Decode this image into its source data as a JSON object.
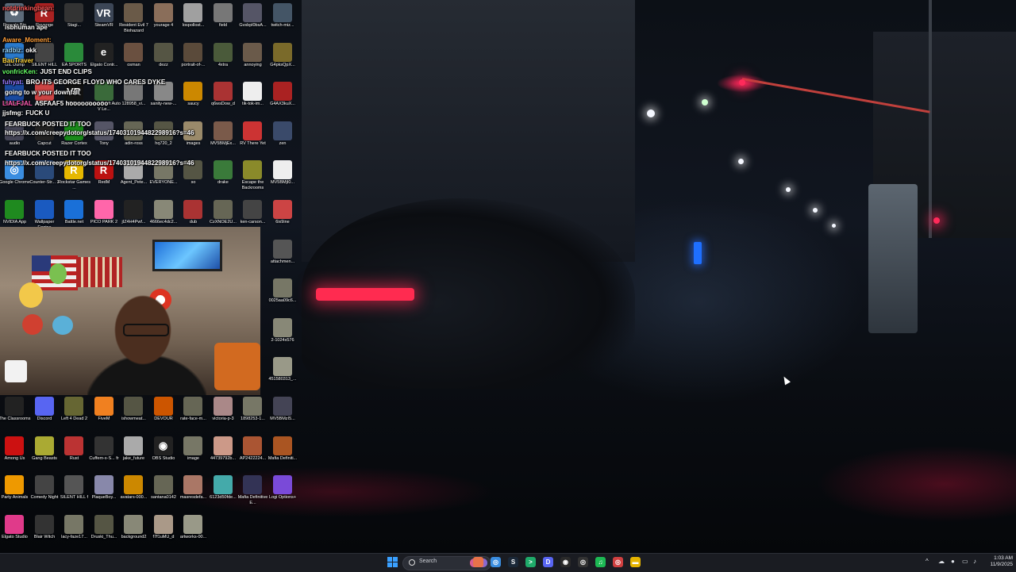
{
  "chat": {
    "messages": [
      {
        "user": "notdrinkingbean:",
        "text": "",
        "color": "#ff5a5a"
      },
      {
        "user": "",
        "text": "isbhuman ape",
        "color": "#ffffff"
      },
      {
        "user": "Aware_Moment:",
        "text": "",
        "color": "#ff9f3a"
      },
      {
        "user": "radbiz:",
        "text": "okk",
        "color": "#9ad8ff"
      },
      {
        "user": "BauTraver",
        "text": "",
        "color": "#ffd23a"
      },
      {
        "user": "vonfricKen:",
        "text": "JUST END CLIPS",
        "color": "#66ff66"
      },
      {
        "user": "fuhyat:",
        "text": "BRO ITS GEORGE FLOYD WHO CARES DYKE",
        "color": "#9a7aff"
      },
      {
        "user": "",
        "text": "going to w your downfall",
        "color": "#ffffff"
      },
      {
        "user": "LIALFJAL",
        "text": "ASFAAF5  hoooooooooo",
        "color": "#ff5ab4"
      },
      {
        "user": "jjsfmg:",
        "text": "FUCK U",
        "color": "#ffffff"
      },
      {
        "user": "",
        "text": "FEARBUCK POSTED IT TOO",
        "color": "#ffffff"
      },
      {
        "user": "",
        "text": "https://x.com/creepydotorg/status/1740310194482298916?s=46",
        "color": "#ffffff"
      },
      {
        "user": "",
        "text": "FEARBUCK POSTED IT TOO",
        "color": "#ffffff"
      },
      {
        "user": "",
        "text": "https://x.com/creepydotorg/status/1740310194482298916?s=46",
        "color": "#ffffff"
      }
    ]
  },
  "desktop": {
    "icons": [
      {
        "label": "Recycle Bin",
        "icon": "recycle-bin-icon",
        "color": "#5d6b7a",
        "glyph": "♻"
      },
      {
        "label": "Revenge",
        "icon": "game-icon",
        "color": "#a22",
        "glyph": "R"
      },
      {
        "label": "Stagi...",
        "icon": "app-icon",
        "color": "#333",
        "glyph": ""
      },
      {
        "label": "SteamVR",
        "icon": "steamvr-icon",
        "color": "#3c4656",
        "glyph": "VR"
      },
      {
        "label": "Resident Evil 7 Biohazard",
        "icon": "game-icon",
        "color": "#6a5a48",
        "glyph": ""
      },
      {
        "label": "yourage 4",
        "icon": "image-file-icon",
        "color": "#8a6e5a",
        "glyph": ""
      },
      {
        "label": "lospollost...",
        "icon": "image-file-icon",
        "color": "#a0a0a0",
        "glyph": ""
      },
      {
        "label": "field",
        "icon": "image-file-icon",
        "color": "#777",
        "glyph": ""
      },
      {
        "label": "Gvsbpl0bsA...",
        "icon": "image-file-icon",
        "color": "#556",
        "glyph": ""
      },
      {
        "label": "twitch-miz...",
        "icon": "image-file-icon",
        "color": "#456",
        "glyph": ""
      },
      {
        "label": "GIL Dump",
        "icon": "app-icon",
        "color": "#2a7acc",
        "glyph": ""
      },
      {
        "label": "SILENT HILL",
        "icon": "game-icon",
        "color": "#444",
        "glyph": ""
      },
      {
        "label": "EA SPORTS",
        "icon": "game-icon",
        "color": "#2a8a3a",
        "glyph": ""
      },
      {
        "label": "Elgato Contr...",
        "icon": "elgato-icon",
        "color": "#222",
        "glyph": "e"
      },
      {
        "label": "osman",
        "icon": "image-file-icon",
        "color": "#6a5040",
        "glyph": ""
      },
      {
        "label": "dezz",
        "icon": "image-file-icon",
        "color": "#554",
        "glyph": ""
      },
      {
        "label": "portrait-of-...",
        "icon": "image-file-icon",
        "color": "#5a4a3a",
        "glyph": ""
      },
      {
        "label": "4xtra",
        "icon": "image-file-icon",
        "color": "#4a5a3a",
        "glyph": ""
      },
      {
        "label": "annoying",
        "icon": "image-file-icon",
        "color": "#6a5a4a",
        "glyph": ""
      },
      {
        "label": "G4pksQpX...",
        "icon": "image-file-icon",
        "color": "#7a6a2a",
        "glyph": ""
      },
      {
        "label": "PS Remote",
        "icon": "app-icon",
        "color": "#1a4aa0",
        "glyph": ""
      },
      {
        "label": "PEAK",
        "icon": "game-icon",
        "color": "#c44",
        "glyph": ""
      },
      {
        "label": "VRChat",
        "icon": "vrchat-icon",
        "color": "#111",
        "glyph": "VR"
      },
      {
        "label": "Grand Theft Auto V Le...",
        "icon": "game-icon",
        "color": "#3a6a3a",
        "glyph": ""
      },
      {
        "label": "128958_vi...",
        "icon": "image-file-icon",
        "color": "#777",
        "glyph": ""
      },
      {
        "label": "sanity-new-...",
        "icon": "image-file-icon",
        "color": "#888",
        "glyph": ""
      },
      {
        "label": "saucy",
        "icon": "image-file-icon",
        "color": "#c80",
        "glyph": ""
      },
      {
        "label": "q6wsDow_d",
        "icon": "image-file-icon",
        "color": "#a33",
        "glyph": ""
      },
      {
        "label": "tik-tok-im...",
        "icon": "image-file-icon",
        "color": "#eee",
        "glyph": ""
      },
      {
        "label": "G4AX3kuX...",
        "icon": "image-file-icon",
        "color": "#a22",
        "glyph": ""
      },
      {
        "label": "audio",
        "icon": "app-icon",
        "color": "#445",
        "glyph": ""
      },
      {
        "label": "Capcut",
        "icon": "app-icon",
        "color": "#222",
        "glyph": ""
      },
      {
        "label": "Razer Cortex",
        "icon": "razer-icon",
        "color": "#1a8a1a",
        "glyph": ""
      },
      {
        "label": "Tony",
        "icon": "image-file-icon",
        "color": "#556",
        "glyph": ""
      },
      {
        "label": "adin-ross",
        "icon": "image-file-icon",
        "color": "#665",
        "glyph": ""
      },
      {
        "label": "hq720_2",
        "icon": "image-file-icon",
        "color": "#554",
        "glyph": ""
      },
      {
        "label": "images",
        "icon": "image-file-icon",
        "color": "#9a8a6a",
        "glyph": ""
      },
      {
        "label": "MV5BMjEx...",
        "icon": "image-file-icon",
        "color": "#7a5a4a",
        "glyph": ""
      },
      {
        "label": "RV There Yet",
        "icon": "game-icon",
        "color": "#c33",
        "glyph": ""
      },
      {
        "label": "zen",
        "icon": "image-file-icon",
        "color": "#3a4a6a",
        "glyph": ""
      },
      {
        "label": "Google Chrome",
        "icon": "chrome-icon",
        "color": "#3a8de0",
        "glyph": "◎"
      },
      {
        "label": "Counter-Str... 2",
        "icon": "game-icon",
        "color": "#2a4a7a",
        "glyph": ""
      },
      {
        "label": "Rockstar Games ...",
        "icon": "rockstar-icon",
        "color": "#e6b800",
        "glyph": "R"
      },
      {
        "label": "RedM",
        "icon": "game-icon",
        "color": "#b11",
        "glyph": "R"
      },
      {
        "label": "Agent_Pete...",
        "icon": "image-file-icon",
        "color": "#aaa",
        "glyph": ""
      },
      {
        "label": "EVERYONE...",
        "icon": "image-file-icon",
        "color": "#776",
        "glyph": ""
      },
      {
        "label": "so",
        "icon": "image-file-icon",
        "color": "#554",
        "glyph": ""
      },
      {
        "label": "drake",
        "icon": "image-file-icon",
        "color": "#3a7a3a",
        "glyph": ""
      },
      {
        "label": "Escape the Backrooms",
        "icon": "game-icon",
        "color": "#8a8a2a",
        "glyph": ""
      },
      {
        "label": "MV5BMjI0...",
        "icon": "image-file-icon",
        "color": "#eee",
        "glyph": ""
      },
      {
        "label": "NVIDIA App",
        "icon": "nvidia-icon",
        "color": "#1f8a1f",
        "glyph": ""
      },
      {
        "label": "Wallpaper Engine",
        "icon": "wallpaper-engine-icon",
        "color": "#1a5ac0",
        "glyph": ""
      },
      {
        "label": "Battle.net",
        "icon": "battlenet-icon",
        "color": "#1a70d8",
        "glyph": ""
      },
      {
        "label": "PICO PARK 2",
        "icon": "game-icon",
        "color": "#f6a",
        "glyph": ""
      },
      {
        "label": "jIZ4H4Pwf...",
        "icon": "image-file-icon",
        "color": "#222",
        "glyph": ""
      },
      {
        "label": "4666ec4dc2...",
        "icon": "image-file-icon",
        "color": "#887",
        "glyph": ""
      },
      {
        "label": "dub",
        "icon": "image-file-icon",
        "color": "#a33",
        "glyph": ""
      },
      {
        "label": "CzXNOE2U...",
        "icon": "image-file-icon",
        "color": "#665",
        "glyph": ""
      },
      {
        "label": "ken-carson...",
        "icon": "image-file-icon",
        "color": "#444",
        "glyph": ""
      },
      {
        "label": "6ix9ine",
        "icon": "image-file-icon",
        "color": "#c44",
        "glyph": ""
      },
      {
        "label": "attachmen...",
        "icon": "image-file-icon",
        "color": "#555",
        "glyph": ""
      },
      {
        "label": "0025aa09c6...",
        "icon": "image-file-icon",
        "color": "#776",
        "glyph": ""
      },
      {
        "label": "2-1024x576",
        "icon": "image-file-icon",
        "color": "#887",
        "glyph": ""
      },
      {
        "label": "451580313_...",
        "icon": "image-file-icon",
        "color": "#998",
        "glyph": ""
      },
      {
        "label": "The Classrooms",
        "icon": "game-icon",
        "color": "#222",
        "glyph": ""
      },
      {
        "label": "Discord",
        "icon": "discord-icon",
        "color": "#5865f2",
        "glyph": ""
      },
      {
        "label": "Left 4 Dead 2",
        "icon": "game-icon",
        "color": "#663",
        "glyph": ""
      },
      {
        "label": "FiveM",
        "icon": "fivem-icon",
        "color": "#f08020",
        "glyph": ""
      },
      {
        "label": "ishowmeat...",
        "icon": "image-file-icon",
        "color": "#554",
        "glyph": ""
      },
      {
        "label": "DEVOUR",
        "icon": "game-icon",
        "color": "#c50",
        "glyph": ""
      },
      {
        "label": "rate-face-m...",
        "icon": "image-file-icon",
        "color": "#665",
        "glyph": ""
      },
      {
        "label": "victoria-p-3",
        "icon": "image-file-icon",
        "color": "#a88",
        "glyph": ""
      },
      {
        "label": "1898253-1...",
        "icon": "image-file-icon",
        "color": "#776",
        "glyph": ""
      },
      {
        "label": "MV5BMzI5...",
        "icon": "image-file-icon",
        "color": "#445",
        "glyph": ""
      },
      {
        "label": "Among Us",
        "icon": "game-icon",
        "color": "#c11",
        "glyph": ""
      },
      {
        "label": "Gang Beasts",
        "icon": "game-icon",
        "color": "#aa3",
        "glyph": ""
      },
      {
        "label": "Rust",
        "icon": "game-icon",
        "color": "#b33",
        "glyph": ""
      },
      {
        "label": "Cuffem-x-S... fr",
        "icon": "image-file-icon",
        "color": "#333",
        "glyph": ""
      },
      {
        "label": "jake_future",
        "icon": "image-file-icon",
        "color": "#aaa",
        "glyph": ""
      },
      {
        "label": "OBS Studio",
        "icon": "obs-icon",
        "color": "#222",
        "glyph": "◉"
      },
      {
        "label": "image",
        "icon": "image-file-icon",
        "color": "#776",
        "glyph": ""
      },
      {
        "label": "44739792b...",
        "icon": "image-file-icon",
        "color": "#c98",
        "glyph": ""
      },
      {
        "label": "AP2422224...",
        "icon": "image-file-icon",
        "color": "#a53",
        "glyph": ""
      },
      {
        "label": "Mafia Definiti...",
        "icon": "game-icon",
        "color": "#a52",
        "glyph": ""
      },
      {
        "label": "Party Animals",
        "icon": "game-icon",
        "color": "#e90",
        "glyph": ""
      },
      {
        "label": "Comedy Night",
        "icon": "game-icon",
        "color": "#444",
        "glyph": ""
      },
      {
        "label": "SILENT HILL f",
        "icon": "game-icon",
        "color": "#555",
        "glyph": ""
      },
      {
        "label": "PlaqueBoy...",
        "icon": "image-file-icon",
        "color": "#88a",
        "glyph": ""
      },
      {
        "label": "avatars-000...",
        "icon": "image-file-icon",
        "color": "#c80",
        "glyph": ""
      },
      {
        "label": "santana0142",
        "icon": "image-file-icon",
        "color": "#665",
        "glyph": ""
      },
      {
        "label": "masresdefa...",
        "icon": "image-file-icon",
        "color": "#a76",
        "glyph": ""
      },
      {
        "label": "6123d50fde...",
        "icon": "image-file-icon",
        "color": "#4aa",
        "glyph": ""
      },
      {
        "label": "Mafia Definitive E...",
        "icon": "game-icon",
        "color": "#335",
        "glyph": ""
      },
      {
        "label": "Logi Options+",
        "icon": "logi-icon",
        "color": "#7a4ad8",
        "glyph": ""
      },
      {
        "label": "Elgato Studio",
        "icon": "elgato-studio-icon",
        "color": "#e03a8a",
        "glyph": ""
      },
      {
        "label": "Blair Witch",
        "icon": "game-icon",
        "color": "#333",
        "glyph": ""
      },
      {
        "label": "lacy-faze17...",
        "icon": "image-file-icon",
        "color": "#776",
        "glyph": ""
      },
      {
        "label": "Druski_Thu...",
        "icon": "image-file-icon",
        "color": "#554",
        "glyph": ""
      },
      {
        "label": "background2",
        "icon": "image-file-icon",
        "color": "#887",
        "glyph": ""
      },
      {
        "label": "f7f1uMU_d",
        "icon": "image-file-icon",
        "color": "#a98",
        "glyph": ""
      },
      {
        "label": "artworks-00...",
        "icon": "image-file-icon",
        "color": "#998",
        "glyph": ""
      }
    ]
  },
  "taskbar": {
    "search_label": "Search",
    "clock_time": "1:03 AM",
    "clock_date": "11/9/2025",
    "accent": "#3aa0ff",
    "apps": [
      {
        "name": "edge-icon",
        "color": "#e8734a",
        "glyph": ""
      },
      {
        "name": "chrome-icon",
        "color": "#3a8de0",
        "glyph": "◎"
      },
      {
        "name": "steam-icon",
        "color": "#1b2838",
        "glyph": "S"
      },
      {
        "name": "terminal-icon",
        "color": "#1faa6a",
        "glyph": ">"
      },
      {
        "name": "discord-icon",
        "color": "#5865f2",
        "glyph": "D"
      },
      {
        "name": "obs-icon",
        "color": "#2a2a2a",
        "glyph": "◉"
      },
      {
        "name": "app-icon",
        "color": "#333",
        "glyph": "◎"
      },
      {
        "name": "spotify-icon",
        "color": "#1db954",
        "glyph": "♫"
      },
      {
        "name": "chrome-alt-icon",
        "color": "#d04040",
        "glyph": "◎"
      },
      {
        "name": "file-explorer-icon",
        "color": "#e6b400",
        "glyph": "▬"
      }
    ]
  }
}
